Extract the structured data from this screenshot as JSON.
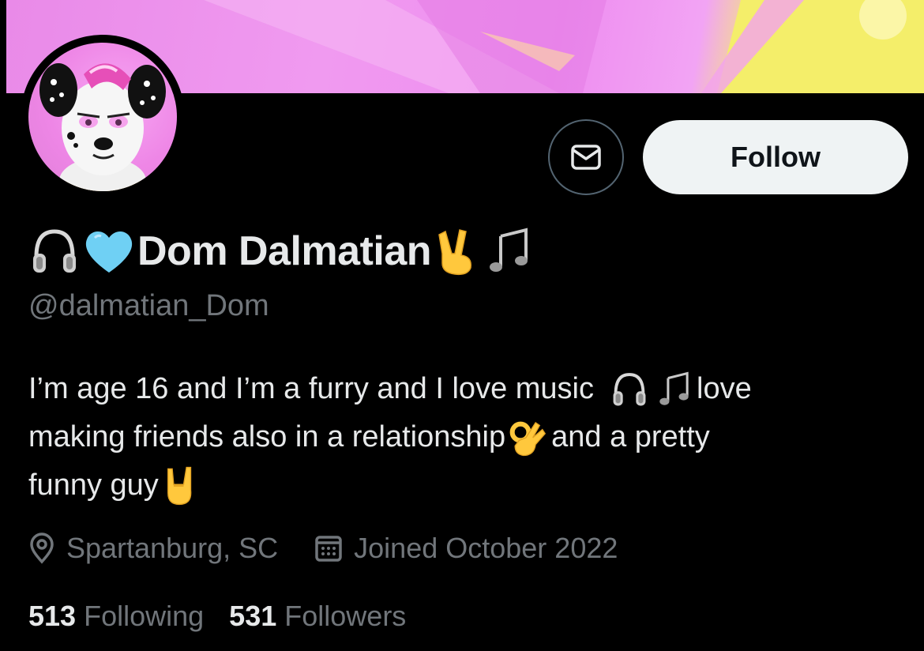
{
  "profile": {
    "display_name": "Dom Dalmatian",
    "name_emojis_before": [
      "headphones-emoji",
      "light-blue-heart-emoji"
    ],
    "name_emojis_after": [
      "victory-hand-emoji",
      "musical-notes-emoji"
    ],
    "handle": "@dalmatian_Dom",
    "bio": {
      "line1_text": "I’m age 16 and I’m a furry and I love music",
      "line1_tail": "love",
      "line2_text": "making friends also in a relationship",
      "line2_tail": "and a pretty",
      "line3_text": "funny guy"
    },
    "location": "Spartanburg, SC",
    "joined": "Joined October 2022",
    "following_count": "513",
    "following_label": "Following",
    "followers_count": "531",
    "followers_label": "Followers"
  },
  "actions": {
    "message_icon": "envelope-icon",
    "follow_label": "Follow"
  },
  "colors": {
    "background": "#000000",
    "text_primary": "#e7e9ea",
    "text_secondary": "#71767b",
    "follow_button_bg": "#eff3f4",
    "banner_pink": "#ee8df0",
    "banner_yellow": "#f4ee6a"
  }
}
